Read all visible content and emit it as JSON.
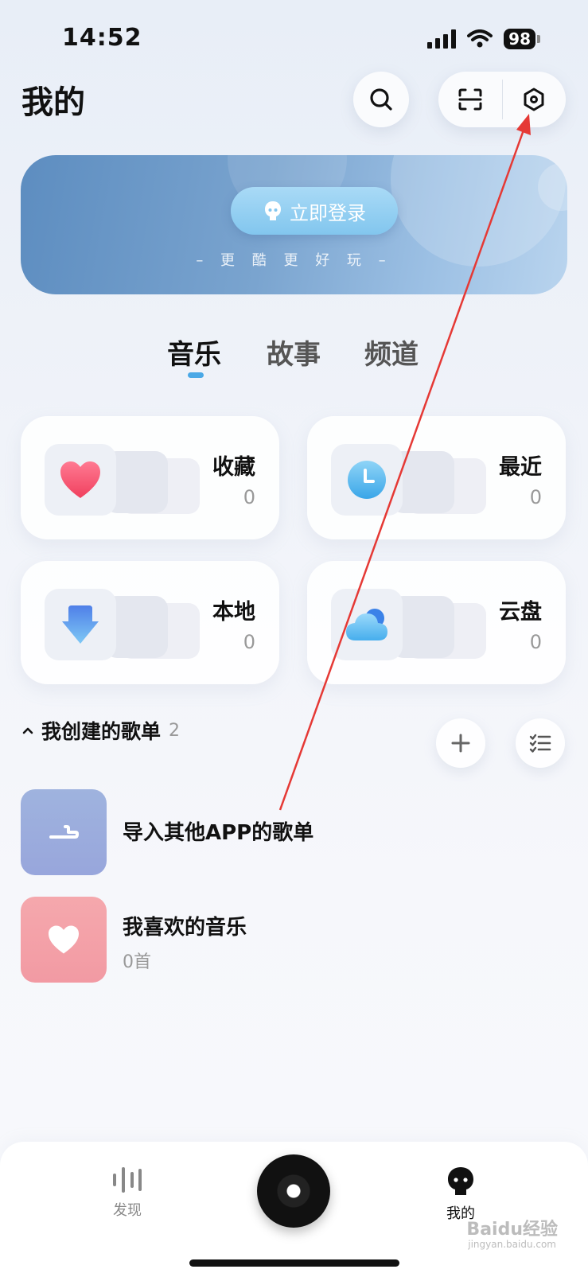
{
  "status_bar": {
    "time": "14:52",
    "battery": "98"
  },
  "header": {
    "title": "我的"
  },
  "banner": {
    "login_label": "立即登录",
    "tagline": "– 更 酷 更 好 玩 –"
  },
  "tabs": [
    {
      "label": "音乐",
      "active": true
    },
    {
      "label": "故事",
      "active": false
    },
    {
      "label": "频道",
      "active": false
    }
  ],
  "cards": [
    {
      "title": "收藏",
      "count": "0",
      "icon": "heart-icon"
    },
    {
      "title": "最近",
      "count": "0",
      "icon": "clock-icon"
    },
    {
      "title": "本地",
      "count": "0",
      "icon": "download-icon"
    },
    {
      "title": "云盘",
      "count": "0",
      "icon": "cloud-icon"
    }
  ],
  "playlist_section": {
    "title": "我创建的歌单",
    "count": "2"
  },
  "playlists": [
    {
      "title": "导入其他APP的歌单",
      "subtitle": "",
      "cover_color": "#9aaedb"
    },
    {
      "title": "我喜欢的音乐",
      "subtitle": "0首",
      "cover_color": "#f2a2aa"
    }
  ],
  "bottom_nav": [
    {
      "label": "发现",
      "icon": "soundwave-icon",
      "active": false
    },
    {
      "label": "我的",
      "icon": "profile-icon",
      "active": true
    }
  ],
  "watermark": {
    "brand": "Baidu经验",
    "url": "jingyan.baidu.com"
  },
  "colors": {
    "accent": "#4aa8e6",
    "annotation_arrow": "#e53935"
  }
}
